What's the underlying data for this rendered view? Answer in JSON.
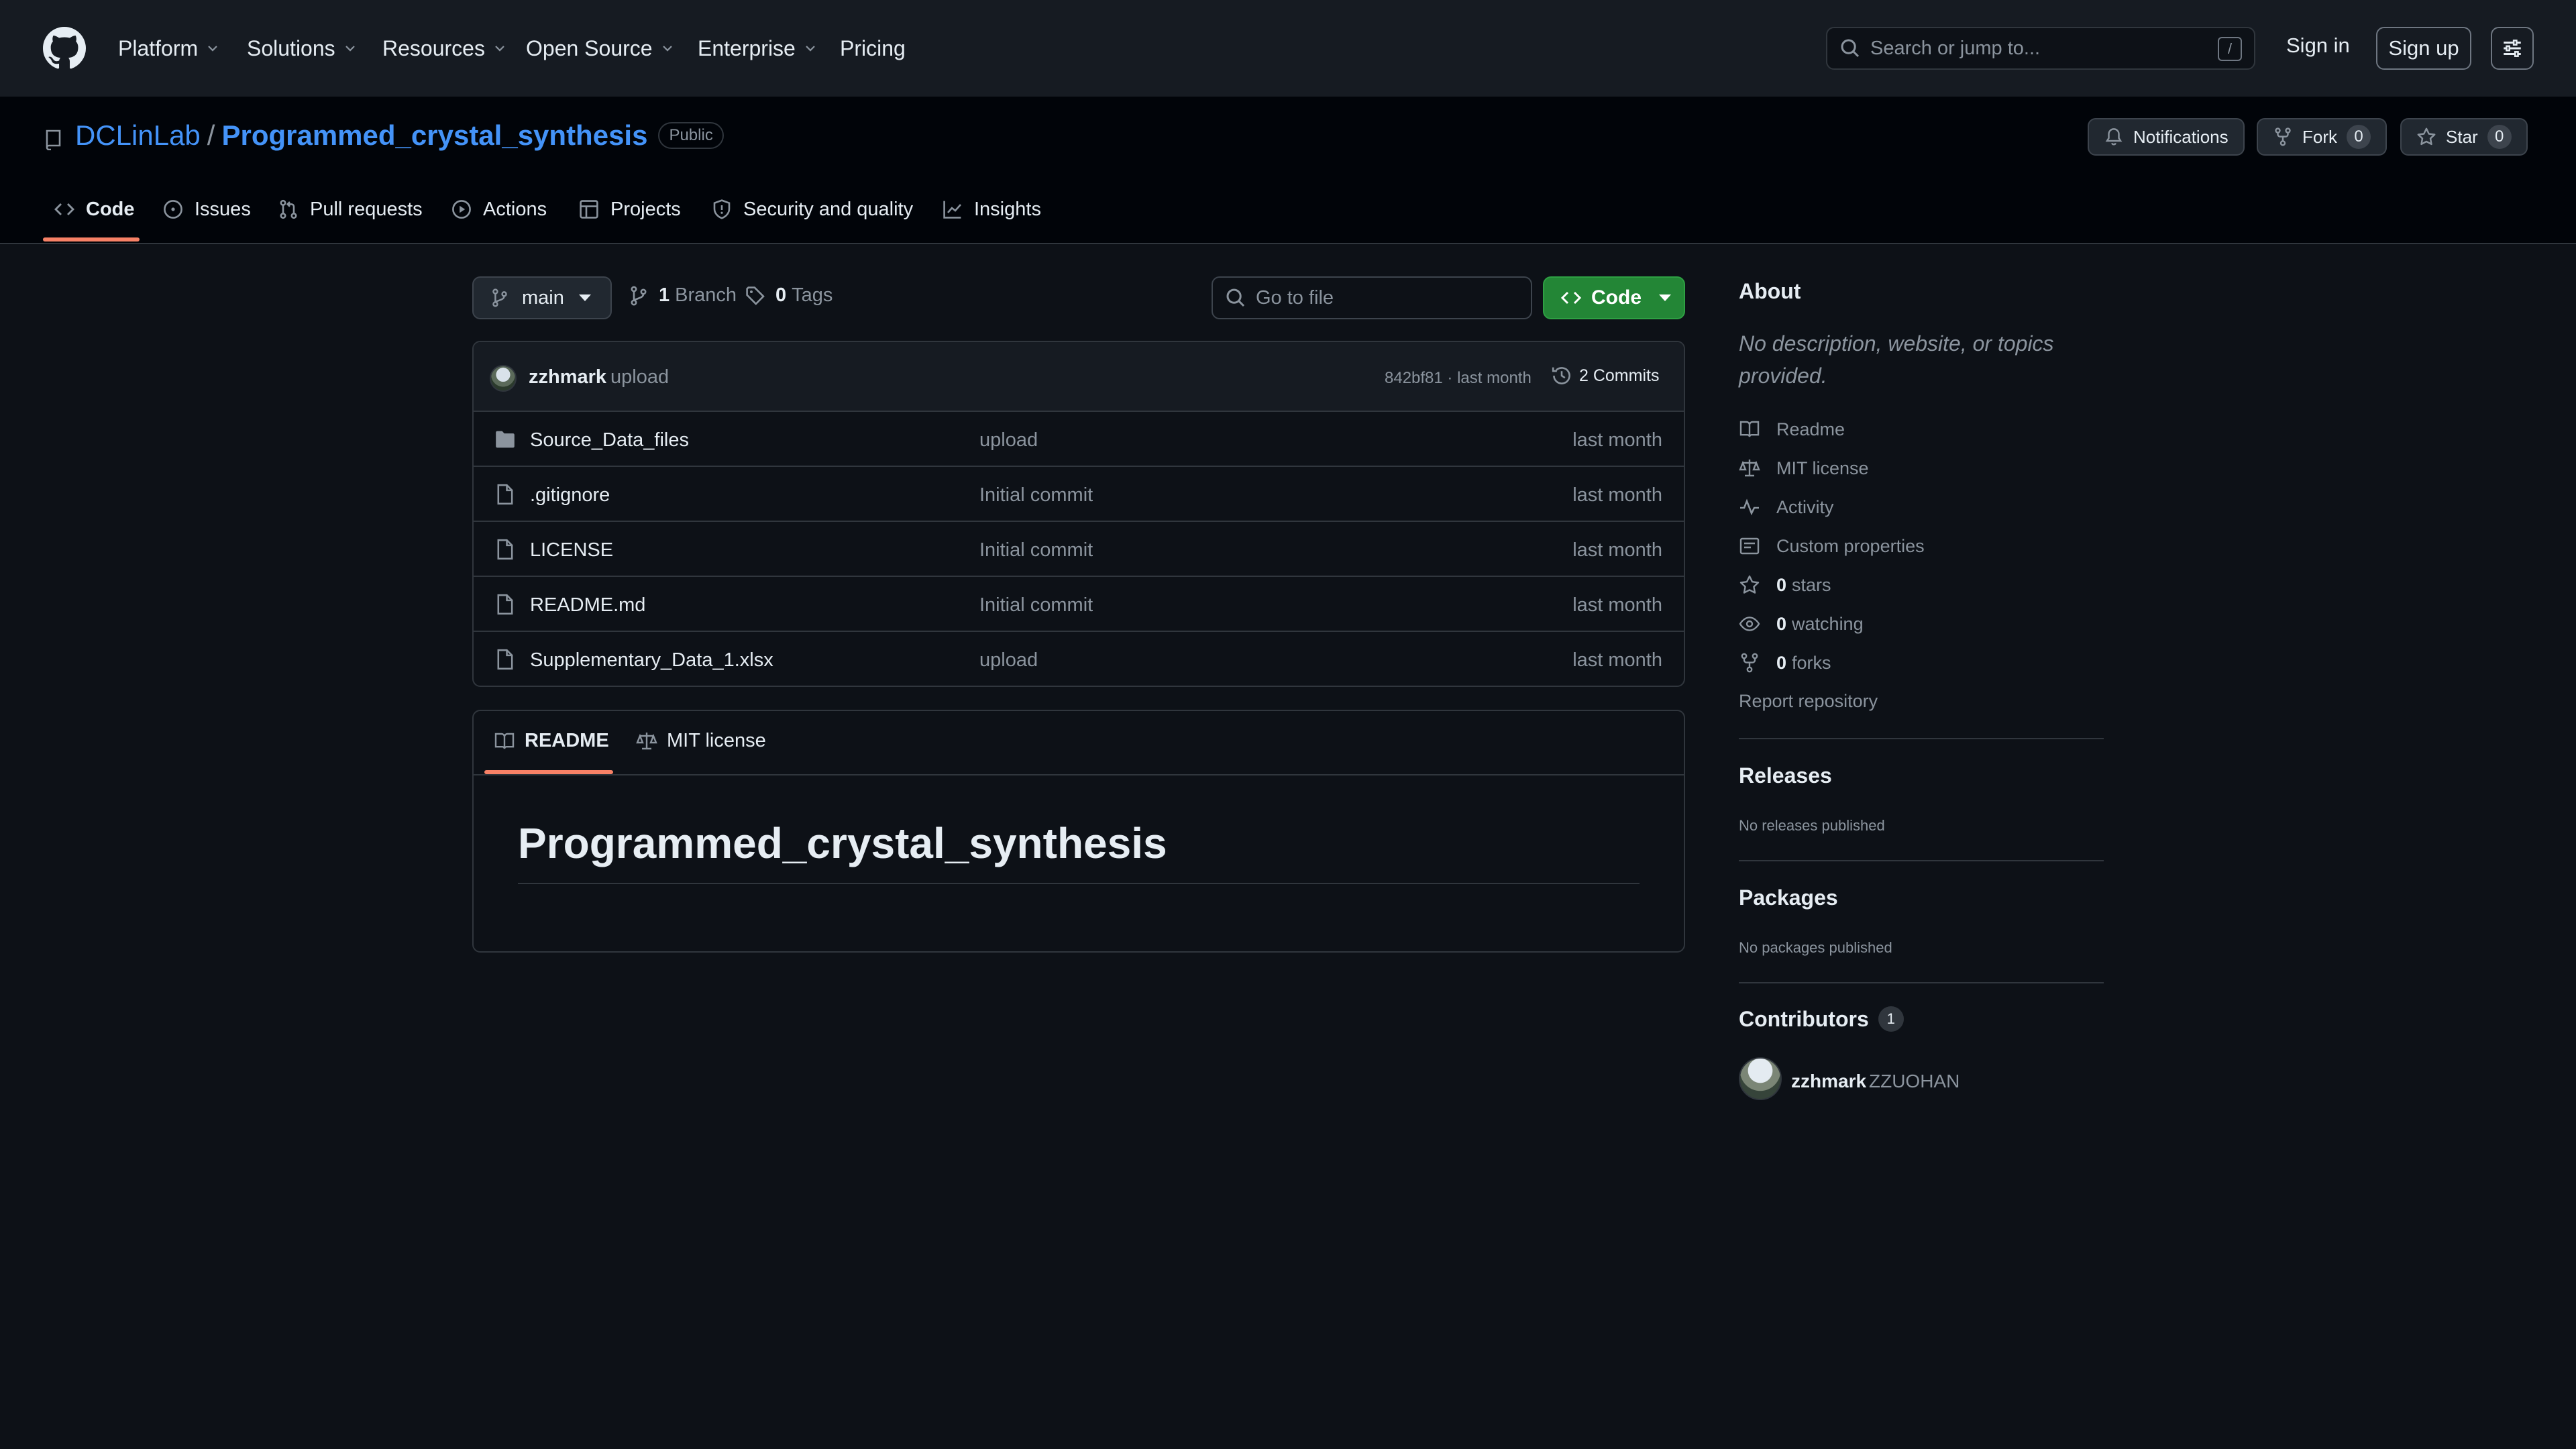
{
  "topnav": {
    "items": [
      "Platform",
      "Solutions",
      "Resources",
      "Open Source",
      "Enterprise"
    ],
    "pricing": "Pricing",
    "search_placeholder": "Search or jump to...",
    "search_key": "/",
    "sign_in": "Sign in",
    "sign_up": "Sign up"
  },
  "repo": {
    "owner": "DCLinLab",
    "separator": "/",
    "name": "Programmed_crystal_synthesis",
    "visibility": "Public",
    "notifications_label": "Notifications",
    "fork_label": "Fork",
    "fork_count": "0",
    "star_label": "Star",
    "star_count": "0",
    "tabs": [
      "Code",
      "Issues",
      "Pull requests",
      "Actions",
      "Projects",
      "Security and quality",
      "Insights"
    ],
    "active_tab": "Code"
  },
  "toolbar": {
    "branch": "main",
    "branch_count": "1",
    "branch_label": "Branch",
    "tag_count": "0",
    "tag_label": "Tags",
    "goto_placeholder": "Go to file",
    "code_label": "Code"
  },
  "latest_commit": {
    "author": "zzhmark",
    "message": "upload",
    "sha_time": "842bf81 · last month",
    "commits_label": "2 Commits"
  },
  "files": [
    {
      "type": "folder",
      "name": "Source_Data_files",
      "message": "upload",
      "time": "last month"
    },
    {
      "type": "file",
      "name": ".gitignore",
      "message": "Initial commit",
      "time": "last month"
    },
    {
      "type": "file",
      "name": "LICENSE",
      "message": "Initial commit",
      "time": "last month"
    },
    {
      "type": "file",
      "name": "README.md",
      "message": "Initial commit",
      "time": "last month"
    },
    {
      "type": "file",
      "name": "Supplementary_Data_1.xlsx",
      "message": "upload",
      "time": "last month"
    }
  ],
  "readme": {
    "tabs": [
      "README",
      "MIT license"
    ],
    "heading": "Programmed_crystal_synthesis"
  },
  "sidebar": {
    "about_title": "About",
    "about_desc": "No description, website, or topics provided.",
    "links": {
      "readme": "Readme",
      "license": "MIT license",
      "activity": "Activity",
      "custom_properties": "Custom properties",
      "stars_count": "0",
      "stars_label": "stars",
      "watching_count": "0",
      "watching_label": "watching",
      "forks_count": "0",
      "forks_label": "forks",
      "report": "Report repository"
    },
    "releases_title": "Releases",
    "releases_empty": "No releases published",
    "packages_title": "Packages",
    "packages_empty": "No packages published",
    "contributors_title": "Contributors",
    "contributors_count": "1",
    "contributor": {
      "login": "zzhmark",
      "name": "ZZUOHAN"
    }
  },
  "colors": {
    "accent_link": "#4493f8",
    "tab_underline": "#f78166",
    "code_button": "#238636",
    "background": "#0d1117"
  }
}
